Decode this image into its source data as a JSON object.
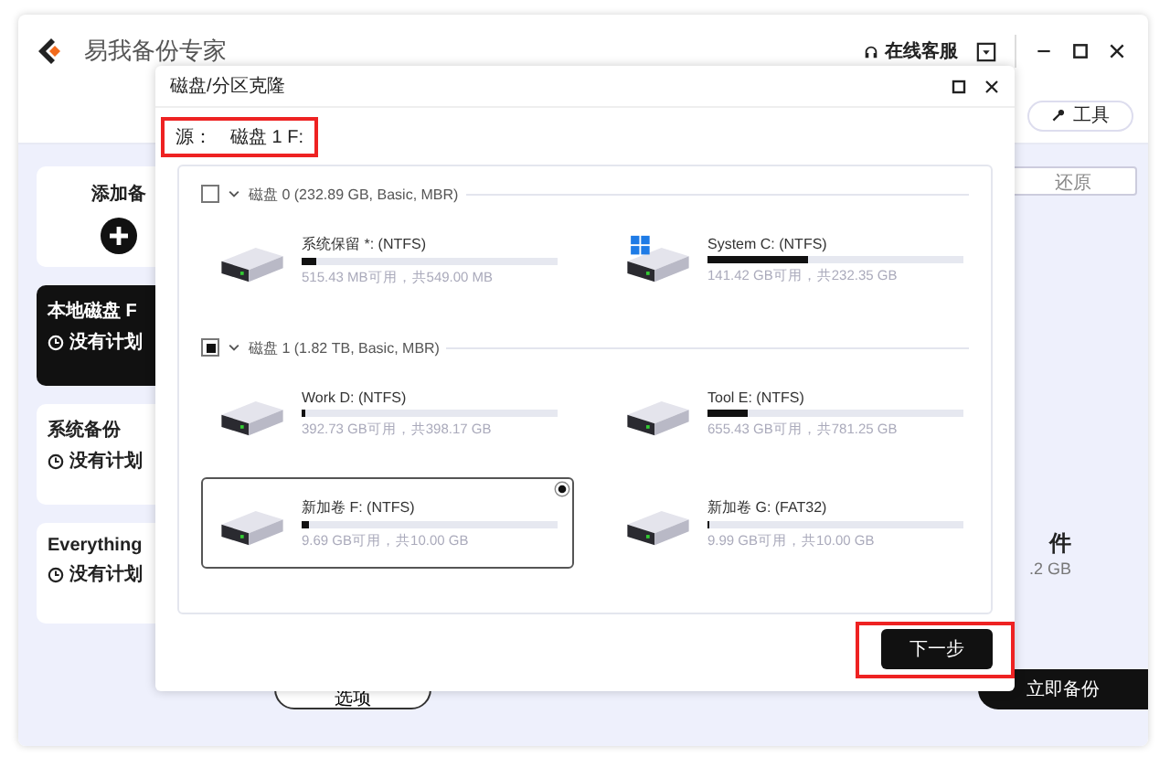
{
  "app": {
    "title": "易我备份专家",
    "support": "在线客服",
    "tools_button": "工具",
    "add_backup": "添加备",
    "tasks": [
      {
        "title": "本地磁盘 F",
        "schedule": "没有计划",
        "selected": true
      },
      {
        "title": "系统备份",
        "schedule": "没有计划",
        "selected": false
      },
      {
        "title": "Everything",
        "schedule": "没有计划",
        "selected": false
      }
    ],
    "restore_button": "还原",
    "summary_title": "件",
    "summary_size": ".2 GB",
    "options_button": "选项",
    "backup_now_button": "立即备份"
  },
  "dialog": {
    "title": "磁盘/分区克隆",
    "source_label": "源：",
    "source_value": "磁盘 1 F:",
    "disks": [
      {
        "label": "磁盘 0 (232.89 GB, Basic, MBR)",
        "checked": false,
        "expanded": true,
        "partitions": [
          {
            "name": "系统保留 *: (NTFS)",
            "kind": "drive",
            "level": 0.06,
            "info": "515.43 MB可用，共549.00 MB",
            "selected": false
          },
          {
            "name": "System C: (NTFS)",
            "kind": "system",
            "level": 0.39,
            "info": "141.42 GB可用，共232.35 GB",
            "selected": false
          }
        ]
      },
      {
        "label": "磁盘 1 (1.82 TB, Basic, MBR)",
        "checked": true,
        "expanded": true,
        "partitions": [
          {
            "name": "Work D: (NTFS)",
            "kind": "drive",
            "level": 0.014,
            "info": "392.73 GB可用，共398.17 GB",
            "selected": false
          },
          {
            "name": "Tool E: (NTFS)",
            "kind": "drive",
            "level": 0.16,
            "info": "655.43 GB可用，共781.25 GB",
            "selected": false
          },
          {
            "name": "新加卷 F: (NTFS)",
            "kind": "drive",
            "level": 0.03,
            "info": "9.69 GB可用，共10.00 GB",
            "selected": true
          },
          {
            "name": "新加卷 G: (FAT32)",
            "kind": "drive",
            "level": 0.01,
            "info": "9.99 GB可用，共10.00 GB",
            "selected": false
          }
        ]
      }
    ],
    "next_button": "下一步"
  }
}
